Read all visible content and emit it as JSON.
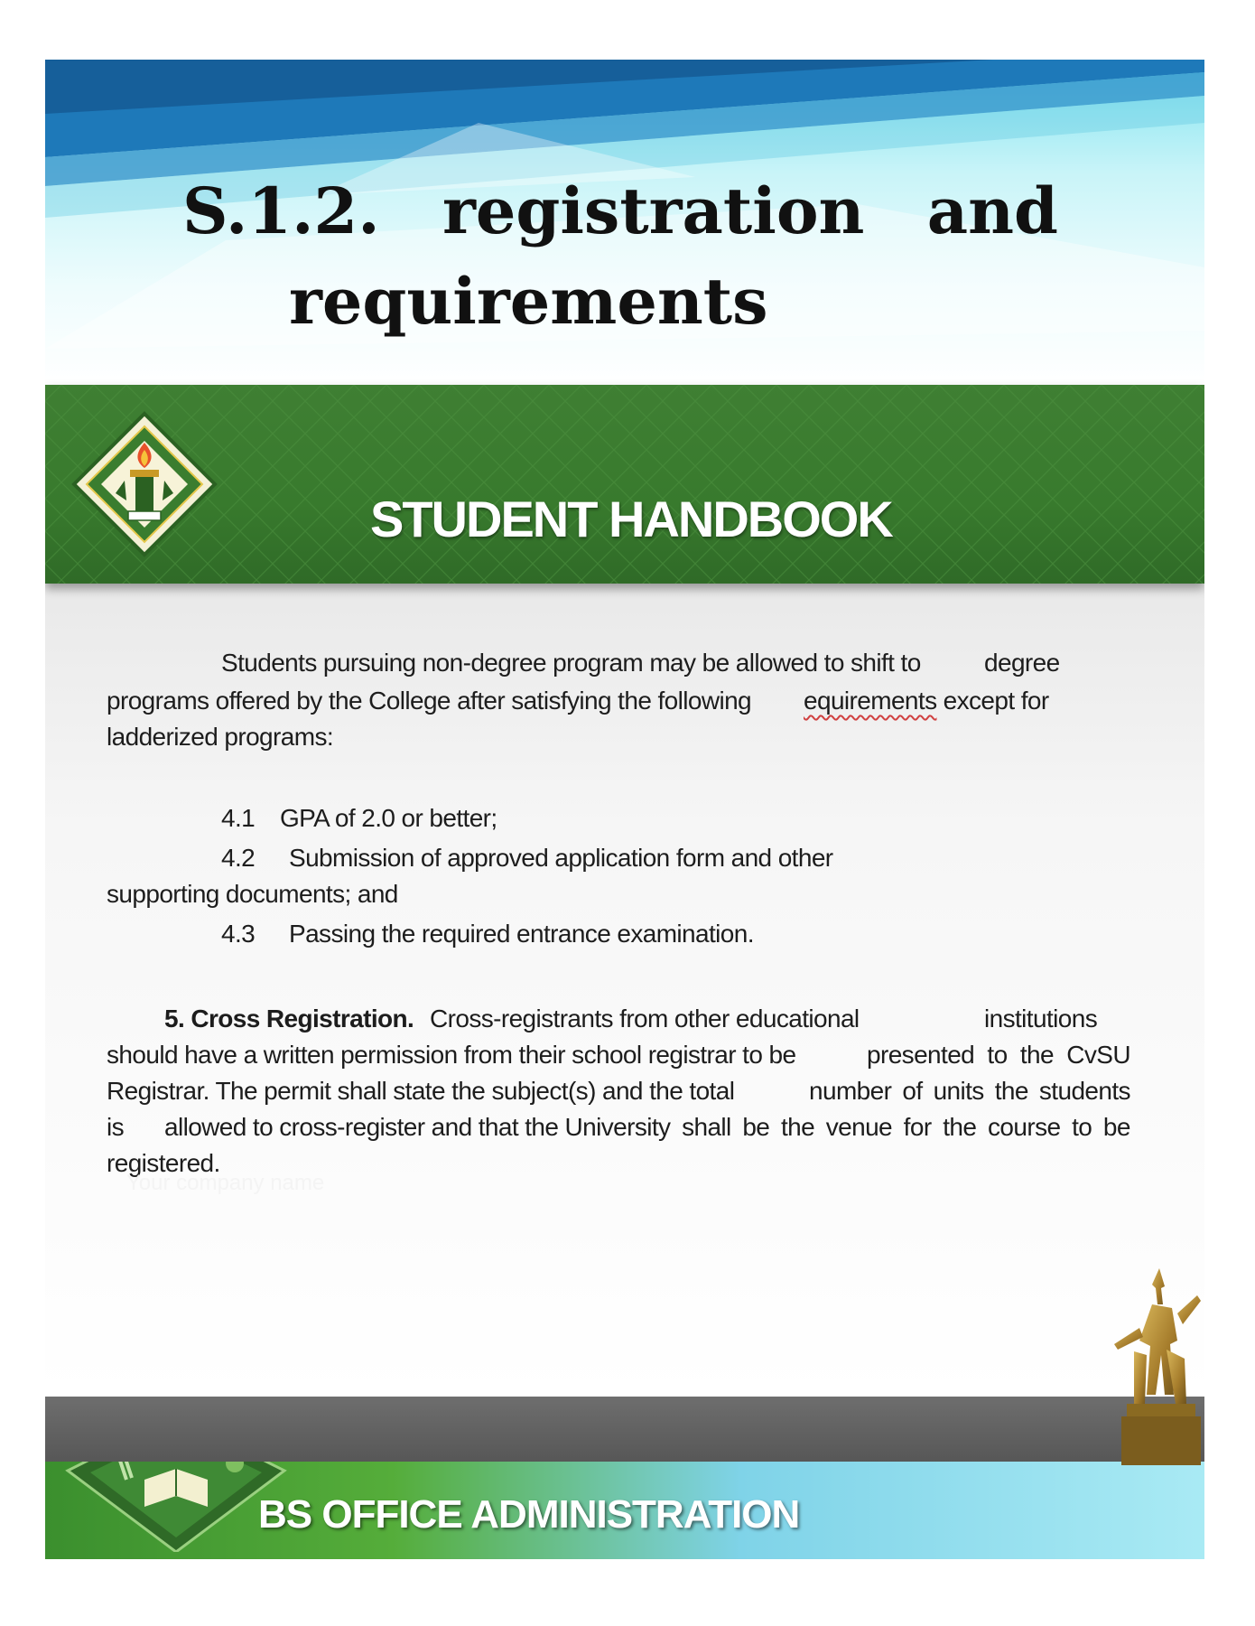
{
  "slide": {
    "title_line1": [
      "S.1.2.",
      "registration",
      "and"
    ],
    "title_line2": "requirements"
  },
  "handbook": {
    "header_title": "STUDENT HANDBOOK"
  },
  "body": {
    "intro_line1_a": "Students pursuing non-degree program may be allowed to shift to",
    "intro_line1_b": "degree",
    "intro_line2_a": "programs offered by the College after satisfying the following",
    "intro_line2_b": "equirements",
    "intro_line2_c": " except for",
    "intro_line3": "ladderized programs:",
    "item_4_1_num": "4.1",
    "item_4_1_text": "GPA of 2.0 or better;",
    "item_4_2_num": "4.2",
    "item_4_2_text": "Submission of approved application form and other",
    "item_4_2_cont": "supporting documents; and",
    "item_4_3_num": "4.3",
    "item_4_3_text": "Passing the required entrance examination.",
    "cross_heading": "5. Cross Registration.",
    "cross_line1_a": "Cross-registrants from other educational",
    "cross_line1_b": "institutions",
    "cross_line2_a": "should have a written permission from their school registrar to be",
    "cross_line2_b": [
      "presented",
      "to",
      "the",
      "CvSU"
    ],
    "cross_line3_a": "Registrar.  The permit shall state the subject(s) and the total",
    "cross_line3_b": [
      "number",
      "of",
      "units",
      "the",
      "students"
    ],
    "cross_line4_a": "is",
    "cross_line4_b": [
      "allowed to cross-register and that the University",
      "shall",
      "be",
      "the",
      "venue",
      "for",
      "the",
      "course",
      "to",
      "be"
    ],
    "cross_line5": "registered.",
    "company_placeholder": "Your company name"
  },
  "footer": {
    "program_title": "BS OFFICE ADMINISTRATION"
  },
  "colors": {
    "header_green": "#387a2d",
    "title_sky": "#7fe3f0",
    "footer_green": "#3b8f2e",
    "footer_cyan": "#a9eaf4"
  }
}
